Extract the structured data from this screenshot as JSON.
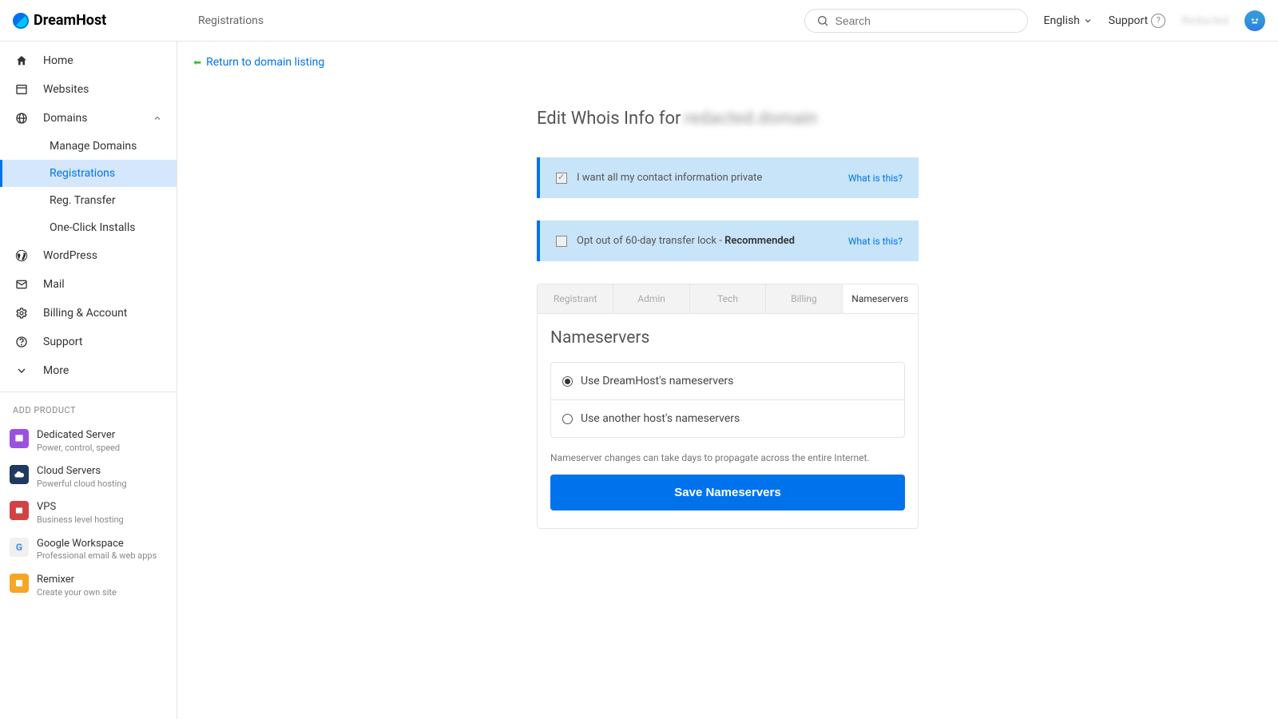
{
  "brand": "DreamHost",
  "header": {
    "breadcrumb": "Registrations",
    "search_placeholder": "Search",
    "language": "English",
    "support": "Support",
    "username": "Redacted"
  },
  "sidebar": {
    "items": [
      {
        "label": "Home",
        "icon": "home"
      },
      {
        "label": "Websites",
        "icon": "websites"
      },
      {
        "label": "Domains",
        "icon": "globe",
        "expanded": true
      },
      {
        "label": "WordPress",
        "icon": "wordpress"
      },
      {
        "label": "Mail",
        "icon": "mail"
      },
      {
        "label": "Billing & Account",
        "icon": "gear"
      },
      {
        "label": "Support",
        "icon": "help"
      },
      {
        "label": "More",
        "icon": "chevron-down"
      }
    ],
    "domains_sub": [
      {
        "label": "Manage Domains"
      },
      {
        "label": "Registrations",
        "active": true
      },
      {
        "label": "Reg. Transfer"
      },
      {
        "label": "One-Click Installs"
      }
    ],
    "add_section": "ADD PRODUCT",
    "products": [
      {
        "title": "Dedicated Server",
        "sub": "Power, control, speed",
        "color": "#9b51e0"
      },
      {
        "title": "Cloud Servers",
        "sub": "Powerful cloud hosting",
        "color": "#1e3a5f"
      },
      {
        "title": "VPS",
        "sub": "Business level hosting",
        "color": "#d14343"
      },
      {
        "title": "Google Workspace",
        "sub": "Professional email & web apps",
        "color": "#f0f0f0"
      },
      {
        "title": "Remixer",
        "sub": "Create your own site",
        "color": "#f5a623"
      }
    ]
  },
  "main": {
    "return_link": "Return to domain listing",
    "page_title_prefix": "Edit Whois Info for",
    "page_title_domain": "redacted.domain",
    "box_private": "I want all my contact information private",
    "box_optout": "Opt out of 60-day transfer lock - ",
    "box_optout_rec": "Recommended",
    "what_is_this": "What is this?",
    "tabs": [
      "Registrant",
      "Admin",
      "Tech",
      "Billing",
      "Nameservers"
    ],
    "panel_title": "Nameservers",
    "ns_options": [
      "Use DreamHost's nameservers",
      "Use another host's nameservers"
    ],
    "note": "Nameserver changes can take days to propagate across the entire Internet.",
    "save_button": "Save Nameservers"
  }
}
